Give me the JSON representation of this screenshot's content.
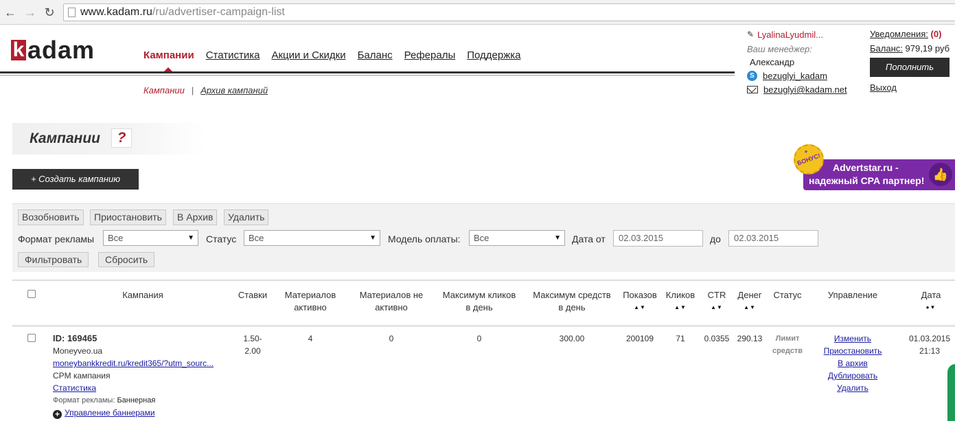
{
  "browser": {
    "url_host": "www.kadam.ru",
    "url_path": "/ru/advertiser-campaign-list"
  },
  "logo": {
    "k": "k",
    "rest": "adam"
  },
  "nav": {
    "items": [
      "Кампании",
      "Статистика",
      "Акции и Скидки",
      "Баланс",
      "Рефералы",
      "Поддержка"
    ],
    "active": 0
  },
  "subnav": {
    "current": "Кампании",
    "separator": "|",
    "archive": "Архив кампаний"
  },
  "user": {
    "name": "LyalinaLyudmil...",
    "manager_label": "Ваш менеджер:",
    "manager_name": "Александр",
    "skype": "bezuglyi_kadam",
    "email": "bezuglyi@kadam.net"
  },
  "account": {
    "notifications_label": "Уведомления:",
    "notifications_count": "(0)",
    "balance_label": "Баланс:",
    "balance_value": "979,19 руб",
    "topup": "Пополнить",
    "logout": "Выход"
  },
  "page": {
    "title": "Кампании",
    "help": "?",
    "create_button": "+ Создать кампанию"
  },
  "banner": {
    "badge_plus": "+",
    "badge_text": "БОНУС!",
    "line1": "Advertstar.ru -",
    "line2": "надежный CPA партнер!"
  },
  "actions": {
    "resume": "Возобновить",
    "pause": "Приостановить",
    "archive": "В Архив",
    "delete": "Удалить"
  },
  "filters": {
    "format_label": "Формат рекламы",
    "format_value": "Все",
    "status_label": "Статус",
    "status_value": "Все",
    "payment_label": "Модель оплаты:",
    "payment_value": "Все",
    "date_from_label": "Дата от",
    "date_from": "02.03.2015",
    "date_to_label": "до",
    "date_to": "02.03.2015",
    "apply": "Фильтровать",
    "reset": "Сбросить"
  },
  "table": {
    "headers": {
      "campaign": "Кампания",
      "bids": "Ставки",
      "mat_active_1": "Материалов",
      "mat_active_2": "активно",
      "mat_inactive_1": "Материалов не",
      "mat_inactive_2": "активно",
      "max_clicks_1": "Максимум кликов",
      "max_clicks_2": "в день",
      "max_funds_1": "Максимум средств",
      "max_funds_2": "в день",
      "shows": "Показов",
      "clicks": "Кликов",
      "ctr": "CTR",
      "money": "Денег",
      "status": "Статус",
      "manage": "Управление",
      "date": "Дата"
    },
    "row": {
      "id": "ID: 169465",
      "site": "Moneyveo.ua",
      "url": "moneybankkredit.ru/kredit365/?utm_sourc...",
      "type": "CPM кампания",
      "stats": "Статистика",
      "format_label": "Формат рекламы:",
      "format_value": "Баннерная",
      "banners_link": "Управление баннерами",
      "bids_1": "1.50-",
      "bids_2": "2.00",
      "mat_active": "4",
      "mat_inactive": "0",
      "max_clicks": "0",
      "max_funds": "300.00",
      "shows": "200109",
      "clicks": "71",
      "ctr": "0.0355",
      "money": "290.13",
      "status_1": "Лимит",
      "status_2": "средств",
      "manage": [
        "Изменить",
        "Приостановить",
        "В архив",
        "Дублировать",
        "Удалить"
      ],
      "date_1": "01.03.2015",
      "date_2": "21:13"
    }
  }
}
